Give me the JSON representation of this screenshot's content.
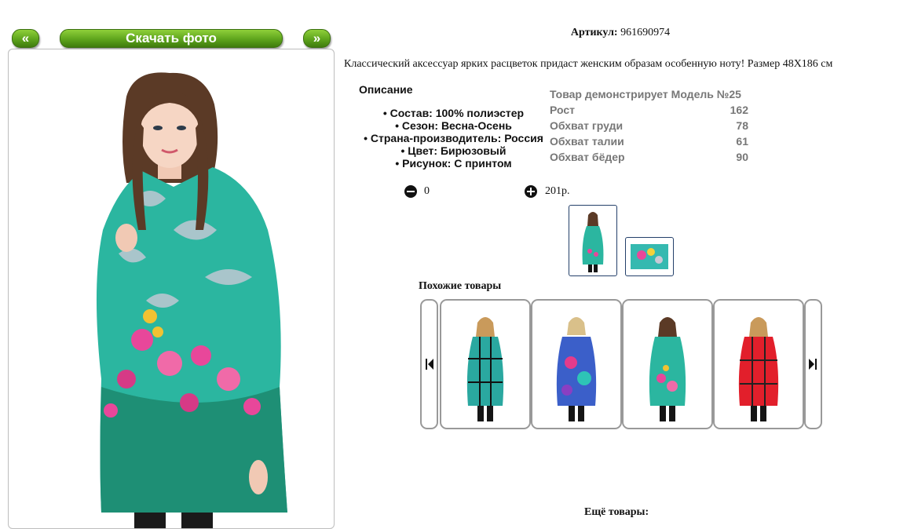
{
  "nav": {
    "prev_label": "«",
    "download_label": "Скачать фото",
    "next_label": "»"
  },
  "product": {
    "article_label": "Артикул:",
    "article_value": "961690974",
    "tagline": "Классический аксессуар ярких расцветок придаст женским образам особенную ноту! Размер 48Х186 см"
  },
  "description": {
    "heading": "Описание",
    "items": [
      "• Состав: 100% полиэстер",
      "• Сезон: Весна-Осень",
      "• Страна-производитель: Россия",
      "• Цвет: Бирюзовый",
      "• Рисунок: С принтом"
    ]
  },
  "model": {
    "heading": "Товар демонстрирует Модель №25",
    "rows": [
      {
        "label": "Рост",
        "value": "162"
      },
      {
        "label": "Обхват груди",
        "value": "78"
      },
      {
        "label": "Обхват талии",
        "value": "61"
      },
      {
        "label": "Обхват бёдер",
        "value": "90"
      }
    ]
  },
  "cart": {
    "quantity": "0",
    "price": "201р."
  },
  "similar": {
    "heading": "Похожие товары"
  },
  "more": {
    "heading": "Ещё товары:"
  },
  "colors": {
    "button_green": "#5ea41c",
    "scarf_teal": "#2bb6a0",
    "thumb_border": "#24406a"
  }
}
